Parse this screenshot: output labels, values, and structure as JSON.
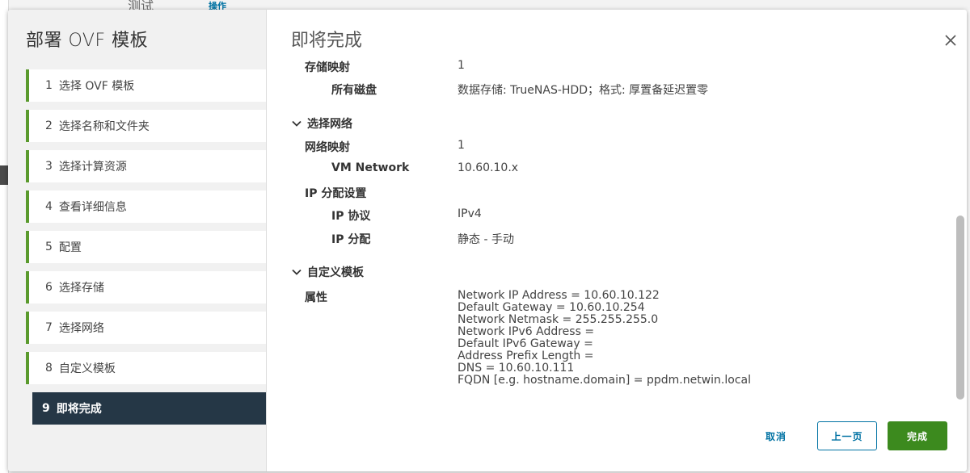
{
  "background": {
    "top_text": "测试",
    "top_action": "操作"
  },
  "wizard": {
    "title": "部署 OVF 模板",
    "steps": [
      {
        "num": "1",
        "label": "选择 OVF 模板"
      },
      {
        "num": "2",
        "label": "选择名称和文件夹"
      },
      {
        "num": "3",
        "label": "选择计算资源"
      },
      {
        "num": "4",
        "label": "查看详细信息"
      },
      {
        "num": "5",
        "label": "配置"
      },
      {
        "num": "6",
        "label": "选择存储"
      },
      {
        "num": "7",
        "label": "选择网络"
      },
      {
        "num": "8",
        "label": "自定义模板"
      },
      {
        "num": "9",
        "label": "即将完成"
      }
    ],
    "active_step": 9
  },
  "content": {
    "title": "即将完成",
    "storage": {
      "mapping_label": "存储映射",
      "mapping_value": "1",
      "all_disks_label": "所有磁盘",
      "all_disks_value": "数据存储: TrueNAS-HDD；格式: 厚置备延迟置零"
    },
    "network": {
      "section_label": "选择网络",
      "mapping_label": "网络映射",
      "mapping_value": "1",
      "vm_network_label": "VM Network",
      "vm_network_value": "10.60.10.x",
      "ip_alloc_label": "IP 分配设置",
      "ip_protocol_label": "IP 协议",
      "ip_protocol_value": "IPv4",
      "ip_allocation_label": "IP 分配",
      "ip_allocation_value": "静态 - 手动"
    },
    "customize": {
      "section_label": "自定义模板",
      "properties_label": "属性",
      "properties": [
        "Network IP Address = 10.60.10.122",
        "Default Gateway = 10.60.10.254",
        "Network Netmask = 255.255.255.0",
        "Network IPv6 Address =",
        "Default IPv6 Gateway =",
        "Address Prefix Length =",
        "DNS = 10.60.10.111",
        "FQDN [e.g. hostname.domain] = ppdm.netwin.local"
      ]
    }
  },
  "footer": {
    "cancel_label": "取消",
    "back_label": "上一页",
    "finish_label": "完成"
  },
  "colors": {
    "accent_green": "#5a9a2d",
    "active_step_bg": "#253746",
    "link_blue": "#0072a3",
    "finish_green": "#3c8a1e"
  }
}
